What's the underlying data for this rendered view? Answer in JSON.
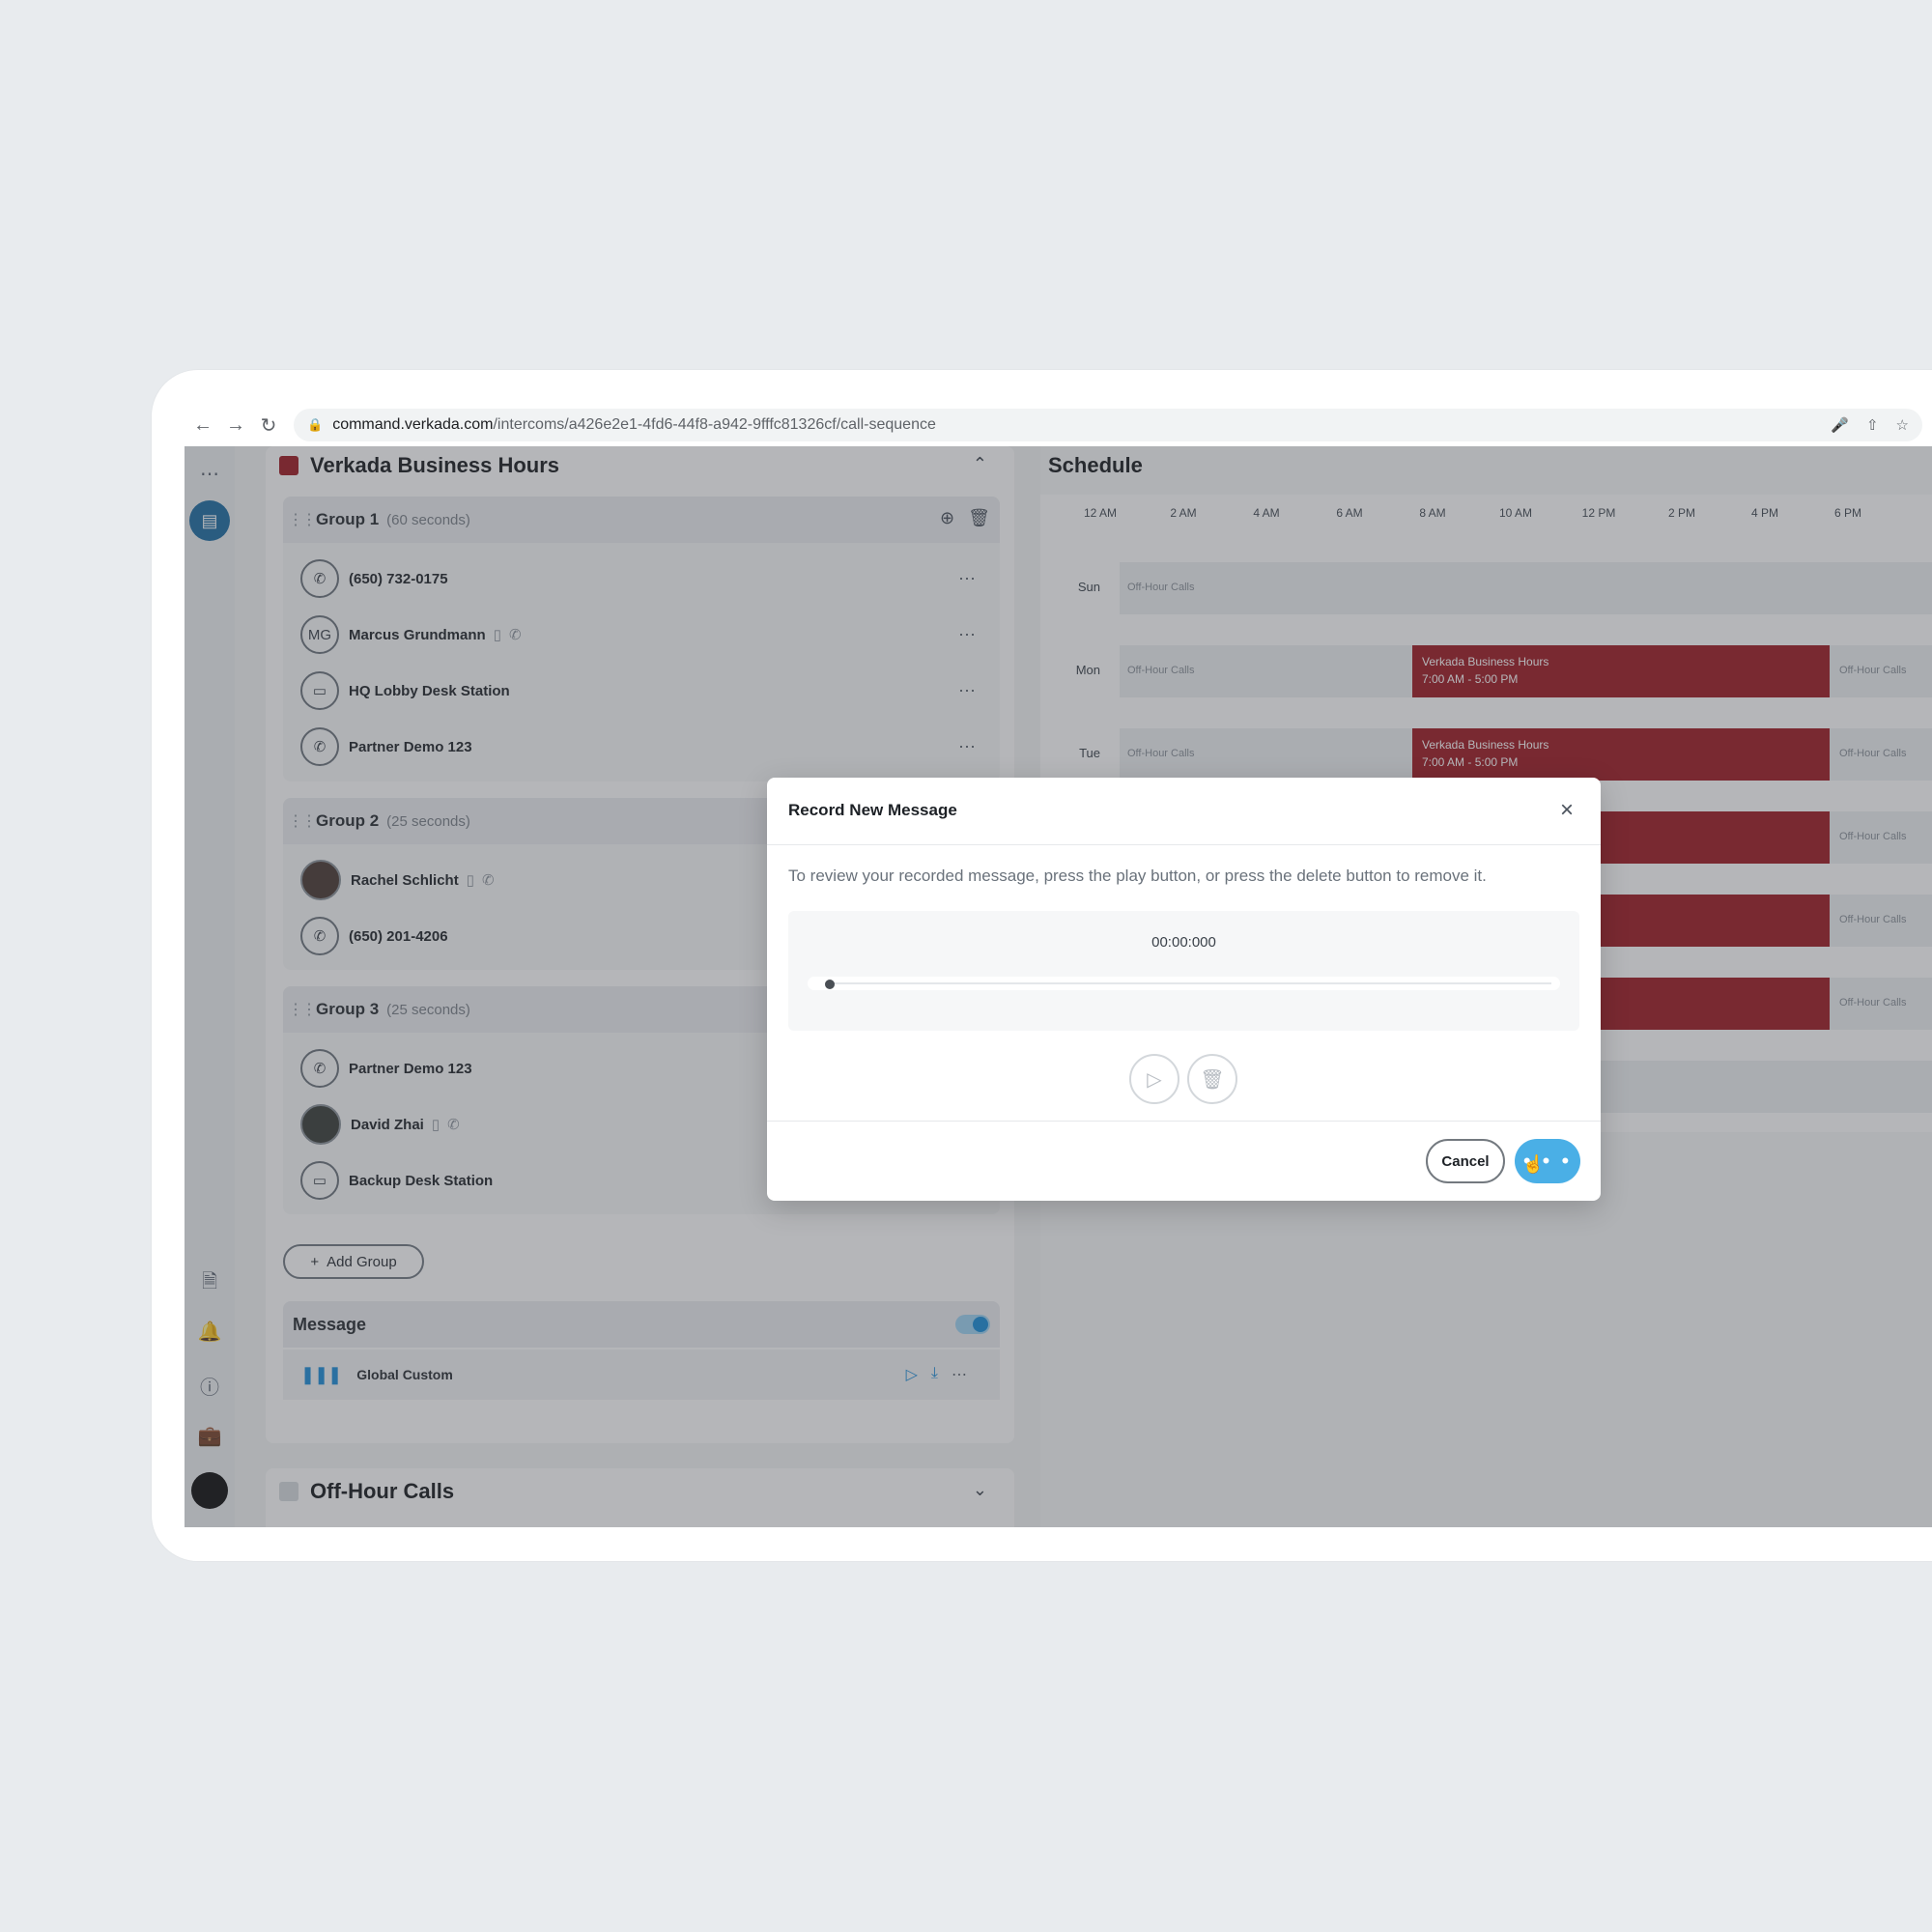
{
  "browser": {
    "url_host": "command.verkada.com",
    "url_path": "/intercoms/a426e2e1-4fd6-44f8-a942-9fffc81326cf/call-sequence"
  },
  "icons": {
    "back": "arrow-left-icon",
    "forward": "arrow-right-icon",
    "reload": "reload-icon",
    "lock": "lock-icon",
    "mic": "microphone-icon",
    "share": "share-icon",
    "star": "star-icon",
    "apps": "app-grid-icon",
    "intercom": "intercom-icon",
    "reports": "document-icon",
    "bell": "bell-icon",
    "help": "help-icon",
    "briefcase": "briefcase-icon"
  },
  "colors": {
    "business_hours": "#9e1c24",
    "accent": "#4aafe6"
  },
  "left": {
    "section_title": "Verkada Business Hours",
    "groups": [
      {
        "name": "Group 1",
        "duration": "(60 seconds)",
        "members": [
          {
            "name": "(650) 732-0175",
            "icon": "phone-icon"
          },
          {
            "name": "Marcus Grundmann",
            "initials": "MG"
          },
          {
            "name": "HQ Lobby Desk Station",
            "icon": "desk-station-icon"
          },
          {
            "name": "Partner Demo 123",
            "icon": "phone-icon"
          }
        ]
      },
      {
        "name": "Group 2",
        "duration": "(25 seconds)",
        "members": [
          {
            "name": "Rachel Schlicht",
            "icon": "avatar-photo"
          },
          {
            "name": "(650) 201-4206",
            "icon": "phone-icon"
          }
        ]
      },
      {
        "name": "Group 3",
        "duration": "(25 seconds)",
        "members": [
          {
            "name": "Partner Demo 123",
            "icon": "phone-icon"
          },
          {
            "name": "David Zhai",
            "icon": "avatar-photo"
          },
          {
            "name": "Backup Desk Station",
            "icon": "desk-station-icon"
          }
        ]
      }
    ],
    "add_group_label": "Add Group",
    "message": {
      "title": "Message",
      "enabled": true,
      "item_name": "Global Custom"
    },
    "off_hour_title": "Off-Hour Calls"
  },
  "schedule": {
    "title": "Schedule",
    "ticks": [
      "12 AM",
      "2 AM",
      "4 AM",
      "6 AM",
      "8 AM",
      "10 AM",
      "12 PM",
      "2 PM",
      "4 PM",
      "6 PM"
    ],
    "days": [
      "Sun",
      "Mon",
      "Tue"
    ],
    "off_hour_label": "Off-Hour Calls",
    "business_label": "Verkada Business Hours",
    "business_time": "7:00 AM - 5:00 PM"
  },
  "modal": {
    "title": "Record New Message",
    "description": "To review your recorded message, press the play button, or press the delete button to remove it.",
    "timecode": "00:00:000",
    "playback_progress": 0,
    "cancel_label": "Cancel",
    "save_label": "• • •"
  }
}
